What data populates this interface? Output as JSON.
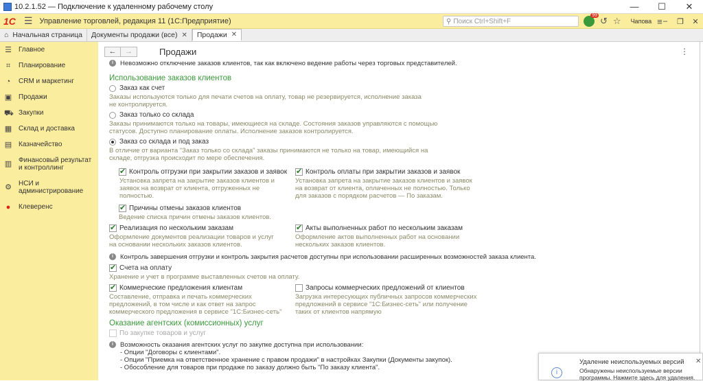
{
  "rdp": {
    "title": "10.2.1.52 — Подключение к удаленному рабочему столу"
  },
  "app": {
    "logo": "1С",
    "title": "Управление торговлей, редакция 11  (1С:Предприятие)",
    "search_placeholder": "Поиск Ctrl+Shift+F",
    "badge": "99",
    "user": "Чапова"
  },
  "tabs": [
    {
      "label": "Начальная страница"
    },
    {
      "label": "Документы продажи (все)"
    },
    {
      "label": "Продажи"
    }
  ],
  "sidebar": {
    "items": [
      {
        "label": "Главное"
      },
      {
        "label": "Планирование"
      },
      {
        "label": "CRM и маркетинг"
      },
      {
        "label": "Продажи"
      },
      {
        "label": "Закупки"
      },
      {
        "label": "Склад и доставка"
      },
      {
        "label": "Казначейство"
      },
      {
        "label": "Финансовый результат и контроллинг"
      },
      {
        "label": "НСИ и администрирование"
      },
      {
        "label": "Клеверенс"
      }
    ]
  },
  "page": {
    "title": "Продажи",
    "info_top": "Невозможно отключение заказов клиентов, так как включено ведение работы через торговых представителей.",
    "section1": "Использование заказов клиентов",
    "r1": {
      "label": "Заказ как счет",
      "desc": "Заказы используются только для печати счетов на оплату, товар не резервируется, исполнение заказа не контролируется."
    },
    "r2": {
      "label": "Заказ только со склада",
      "desc": "Заказы принимаются только на товары, имеющиеся на складе. Состояния заказов управляются с помощью статусов. Доступно планирование оплаты. Исполнение заказов контролируется."
    },
    "r3": {
      "label": "Заказ со склада и под заказ",
      "desc": "В отличие от варианта \"Заказ только со склада\" заказы принимаются не только на товар, имеющийся на складе, отгрузка происходит по мере обеспечения."
    },
    "c1": {
      "label": "Контроль отгрузки при закрытии заказов и заявок",
      "desc": "Установка запрета на закрытие заказов клиентов и заявок на возврат от клиента, отгруженных не полностью."
    },
    "c2": {
      "label": "Контроль оплаты при закрытии заказов и заявок",
      "desc": "Установка запрета на закрытие заказов клиентов и заявок на возврат от клиента, оплаченных не полностью. Только для заказов с порядком расчетов — По заказам."
    },
    "c3": {
      "label": "Причины отмены заказов клиентов",
      "desc": "Ведение списка причин отмены заказов клиентов."
    },
    "c4": {
      "label": "Реализация по нескольким заказам",
      "desc": "Оформление документов реализации товаров и услуг на основании нескольких заказов клиентов."
    },
    "c5": {
      "label": "Акты выполненных работ по нескольким заказам",
      "desc": "Оформление актов выполненных работ на основании нескольких заказов клиентов."
    },
    "info_mid": "Контроль завершения отгрузки и контроль закрытия расчетов доступны при использовании расширенных возможностей заказа клиента.",
    "c6": {
      "label": "Счета на оплату",
      "desc": "Хранение и учет в программе выставленных счетов на оплату."
    },
    "c7": {
      "label": "Коммерческие предложения клиентам",
      "desc": "Составление, отправка и печать коммерческих предложений, в том числе и как ответ на запрос коммерческого предложения в сервисе \"1С:Бизнес-сеть\""
    },
    "c8": {
      "label": "Запросы коммерческих предложений от клиентов",
      "desc": "Загрузка интересующих публичных запросов коммерческих предложений в сервисе \"1С:Бизнес-сеть\" или получение таких от клиентов напрямую"
    },
    "section2": "Оказание агентских (комиссионных) услуг",
    "c9": {
      "label": "По закупке товаров и услуг"
    },
    "info_bottom": [
      "Возможность оказания агентских услуг по закупке доступна при использовании:",
      "- Опции \"Договоры с клиентами\".",
      "- Опции \"Приемка на ответственное хранение с правом продажи\" в настройках Закупки (Документы закупок).",
      "- Обособление для товаров при продаже по заказу должно быть \"По заказу клиента\"."
    ]
  },
  "toast": {
    "title": "Удаление неиспользуемых версий",
    "body": "Обнаружены неиспользуемые версии программы. Нажмите здесь для удаления."
  }
}
